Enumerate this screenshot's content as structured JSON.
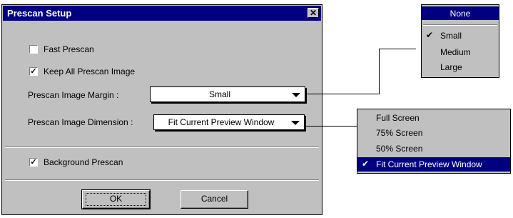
{
  "dialog": {
    "title": "Prescan Setup",
    "close_label": "✕",
    "fast_prescan": {
      "label": "Fast Prescan",
      "checked": false,
      "mark": ""
    },
    "keep_all": {
      "label": "Keep All Prescan Image",
      "checked": true,
      "mark": "✓"
    },
    "margin": {
      "label": "Prescan Image Margin :",
      "value": "Small"
    },
    "dimension": {
      "label": "Prescan Image Dimension :",
      "value": "Fit Current Preview Window"
    },
    "background": {
      "label": "Background Prescan",
      "checked": true,
      "mark": "✓"
    },
    "ok_label": "OK",
    "cancel_label": "Cancel"
  },
  "margin_menu": {
    "items": [
      {
        "label": "None",
        "selected": true,
        "check": ""
      },
      {
        "label": "Small",
        "selected": false,
        "check": "✔"
      },
      {
        "label": "Medium",
        "selected": false,
        "check": ""
      },
      {
        "label": "Large",
        "selected": false,
        "check": ""
      }
    ]
  },
  "dimension_menu": {
    "items": [
      {
        "label": "Full Screen",
        "selected": false,
        "check": ""
      },
      {
        "label": "75% Screen",
        "selected": false,
        "check": ""
      },
      {
        "label": "50% Screen",
        "selected": false,
        "check": ""
      },
      {
        "label": "Fit Current Preview Window",
        "selected": true,
        "check": "✔"
      }
    ]
  },
  "colors": {
    "title_bar": "#000080",
    "face": "#c0c0c0",
    "highlight": "#000080"
  }
}
